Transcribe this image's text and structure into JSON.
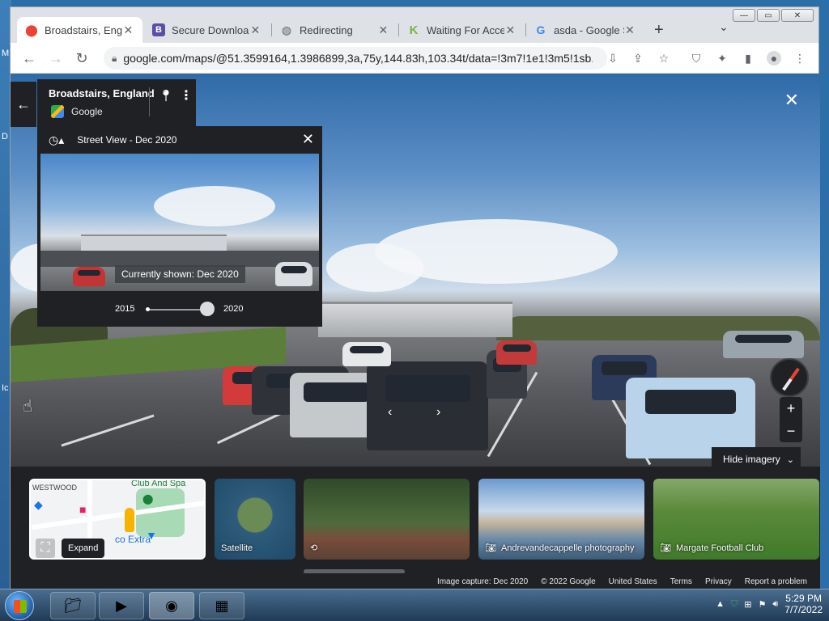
{
  "desktop": {
    "labels": [
      "M",
      "D",
      "Ic"
    ]
  },
  "browser": {
    "tabs": [
      {
        "title": "Broadstairs, Engl",
        "favicon": "maps-pin-icon",
        "active": true
      },
      {
        "title": "Secure Downloa",
        "favicon": "B",
        "active": false
      },
      {
        "title": "Redirecting",
        "favicon": "globe-icon",
        "active": false
      },
      {
        "title": "Waiting For Acce",
        "favicon": "K",
        "active": false
      },
      {
        "title": "asda - Google Se",
        "favicon": "G",
        "active": false
      }
    ],
    "new_tab": "+",
    "tab_close": "✕",
    "url": "google.com/maps/@51.3599164,1.3986899,3a,75y,144.83h,103.34t/data=!3m7!1e1!3m5!1sb...",
    "win_min": "—",
    "win_max": "▭",
    "win_close": "✕"
  },
  "streetview": {
    "close": "✕",
    "back": "←",
    "place_name": "Broadstairs, England",
    "provider": "Google",
    "time_machine": {
      "title": "Street View - Dec 2020",
      "close": "✕",
      "currently_shown": "Currently shown: Dec 2020",
      "year_start": "2015",
      "year_end": "2020",
      "slider_fraction": 1.0
    },
    "zoom_in": "+",
    "zoom_out": "−",
    "hide_imagery": "Hide imagery",
    "nav_prev": "‹",
    "nav_next": "›"
  },
  "filmstrip": {
    "minimap_labels": [
      "WESTWOOD",
      "Club And Spa",
      "co Extra"
    ],
    "expand_tooltip": "Expand",
    "thumbs": [
      {
        "label": "Satellite"
      },
      {
        "label": ""
      },
      {
        "label": "Andrevandecappelle photography"
      },
      {
        "label": "Margate Football Club"
      }
    ]
  },
  "footer": {
    "items": [
      "Image capture: Dec 2020",
      "© 2022 Google",
      "United States",
      "Terms",
      "Privacy",
      "Report a problem"
    ]
  },
  "taskbar": {
    "time": "5:29 PM",
    "date": "7/7/2022"
  }
}
